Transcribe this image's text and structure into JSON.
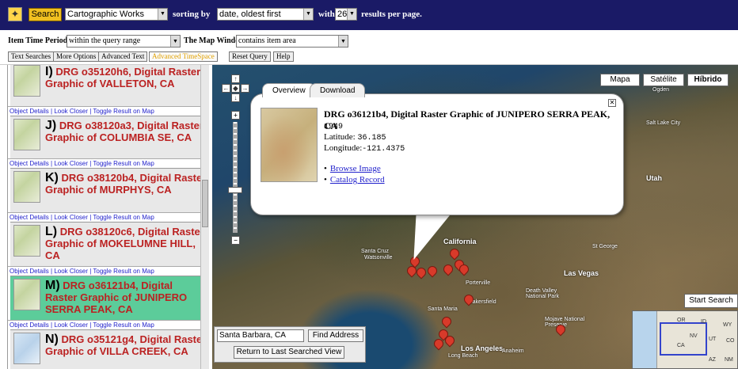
{
  "toolbar": {
    "search_label": "Search",
    "collection": "Cartographic Works",
    "sorting_by_label": "sorting by",
    "sort": "date, oldest first",
    "with_label": "with",
    "results_count": "26",
    "results_suffix": "results per page."
  },
  "filters": {
    "time_period_label": "Item Time Period",
    "time_period_value": "within the query range",
    "map_window_label": "The Map Window",
    "map_window_value": "contains item area"
  },
  "tabs": [
    "Text Searches",
    "More Options",
    "Advanced Text",
    "Advanced TimeSpace"
  ],
  "buttons": {
    "reset_query": "Reset Query",
    "help": "Help"
  },
  "results": [
    {
      "letter": "I)",
      "title": "DRG o35120h6, Digital Raster Graphic of VALLETON, CA"
    },
    {
      "letter": "J)",
      "title": "DRG o38120a3, Digital Raster Graphic of COLUMBIA SE, CA"
    },
    {
      "letter": "K)",
      "title": "DRG o38120b4, Digital Raster Graphic of MURPHYS, CA"
    },
    {
      "letter": "L)",
      "title": "DRG o38120c6, Digital Raster Graphic of MOKELUMNE HILL, CA"
    },
    {
      "letter": "M)",
      "title": "DRG o36121b4, Digital Raster Graphic of JUNIPERO SERRA PEAK, CA"
    },
    {
      "letter": "N)",
      "title": "DRG o35121g4, Digital Raster Graphic of VILLA CREEK, CA"
    }
  ],
  "result_links": "Object Details | Look Closer | Toggle Result on Map",
  "map": {
    "types": [
      "Mapa",
      "Satélite",
      "Híbrido"
    ],
    "popup": {
      "tabs": [
        "Overview",
        "Download"
      ],
      "title": "DRG o36121b4, Digital Raster Graphic of JUNIPERO SERRA PEAK, CA",
      "year": "1949",
      "latitude_label": "Latitude:",
      "latitude": "36.185",
      "longitude_label": "Longitude:",
      "longitude": "-121.4375",
      "links": [
        "Browse Image",
        "Catalog Record"
      ]
    },
    "labels": {
      "california": "California",
      "las_vegas": "Las Vegas",
      "death_valley": "Death Valley National Park",
      "bakersfield": "Bakersfield",
      "los_angeles": "Los Angeles",
      "long_beach": "Long Beach",
      "anaheim": "Anaheim",
      "santa_cruz": "Santa Cruz",
      "watsonville": "Watsonville",
      "utah": "Utah",
      "st_george": "St George",
      "salt_lake_city": "Salt Lake City",
      "ogden": "Ogden",
      "porterville": "Porterville",
      "santa_maria": "Santa Maria",
      "mojave": "Mojave National Preserve"
    },
    "address_input": "Santa Barbara, CA",
    "find_address": "Find Address",
    "return_last": "Return to Last Searched View",
    "start_search": "Start Search",
    "overview_labels": {
      "or": "OR",
      "id": "ID",
      "wy": "WY",
      "nv": "NV",
      "ut": "UT",
      "co": "CO",
      "ca": "CA",
      "az": "AZ",
      "nm": "NM"
    }
  }
}
